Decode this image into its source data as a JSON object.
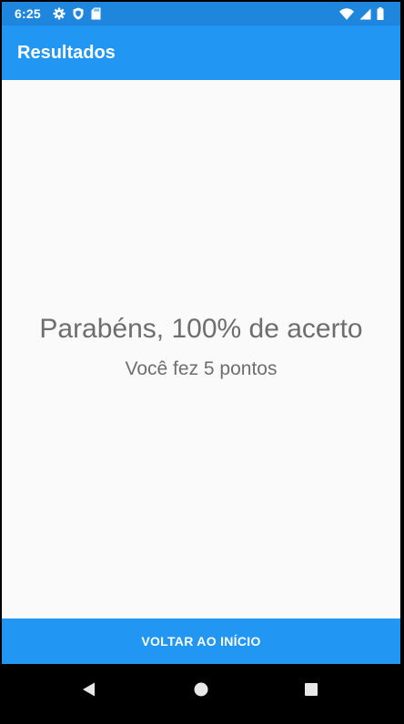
{
  "status_bar": {
    "time": "6:25",
    "left_icons": [
      "gear-icon",
      "shield-icon",
      "sd-card-icon"
    ],
    "right_icons": [
      "wifi-icon",
      "signal-icon",
      "battery-icon"
    ]
  },
  "app_bar": {
    "title": "Resultados"
  },
  "main": {
    "headline": "Parabéns, 100% de acerto",
    "subline": "Você fez 5 pontos"
  },
  "footer": {
    "button_label": "VOLTAR AO INÍCIO"
  },
  "nav_bar": {
    "buttons": [
      "back-icon",
      "home-icon",
      "recents-icon"
    ]
  },
  "colors": {
    "status_bar": "#1f86dd",
    "primary": "#2196f3",
    "content_background": "#fafafa",
    "text_secondary": "#6e6e6e"
  }
}
